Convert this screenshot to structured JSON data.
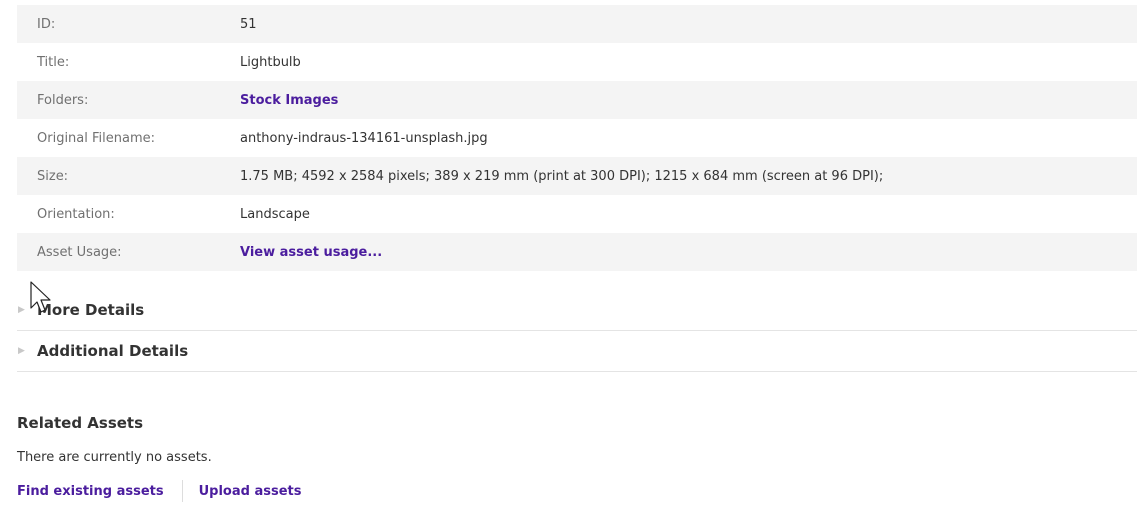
{
  "details": [
    {
      "label": "ID:",
      "value": "51",
      "is_link": false
    },
    {
      "label": "Title:",
      "value": "Lightbulb",
      "is_link": false
    },
    {
      "label": "Folders:",
      "value": "Stock Images",
      "is_link": true
    },
    {
      "label": "Original Filename:",
      "value": "anthony-indraus-134161-unsplash.jpg",
      "is_link": false
    },
    {
      "label": "Size:",
      "value": "1.75 MB; 4592 x 2584 pixels; 389 x 219 mm (print at 300 DPI); 1215 x 684 mm (screen at 96 DPI);",
      "is_link": false
    },
    {
      "label": "Orientation:",
      "value": "Landscape",
      "is_link": false
    },
    {
      "label": "Asset Usage:",
      "value": "View asset usage...",
      "is_link": true
    }
  ],
  "sections": {
    "more_details": "More Details",
    "additional_details": "Additional Details"
  },
  "related": {
    "title": "Related Assets",
    "empty_text": "There are currently no assets.",
    "find_label": "Find existing assets",
    "upload_label": "Upload assets"
  },
  "icons": {
    "collapse_arrow": "triangle-right-icon",
    "cursor": "mouse-pointer-icon"
  },
  "colors": {
    "link": "#4b1d9e",
    "row_stripe": "#f4f4f4",
    "label_text": "#707070"
  }
}
